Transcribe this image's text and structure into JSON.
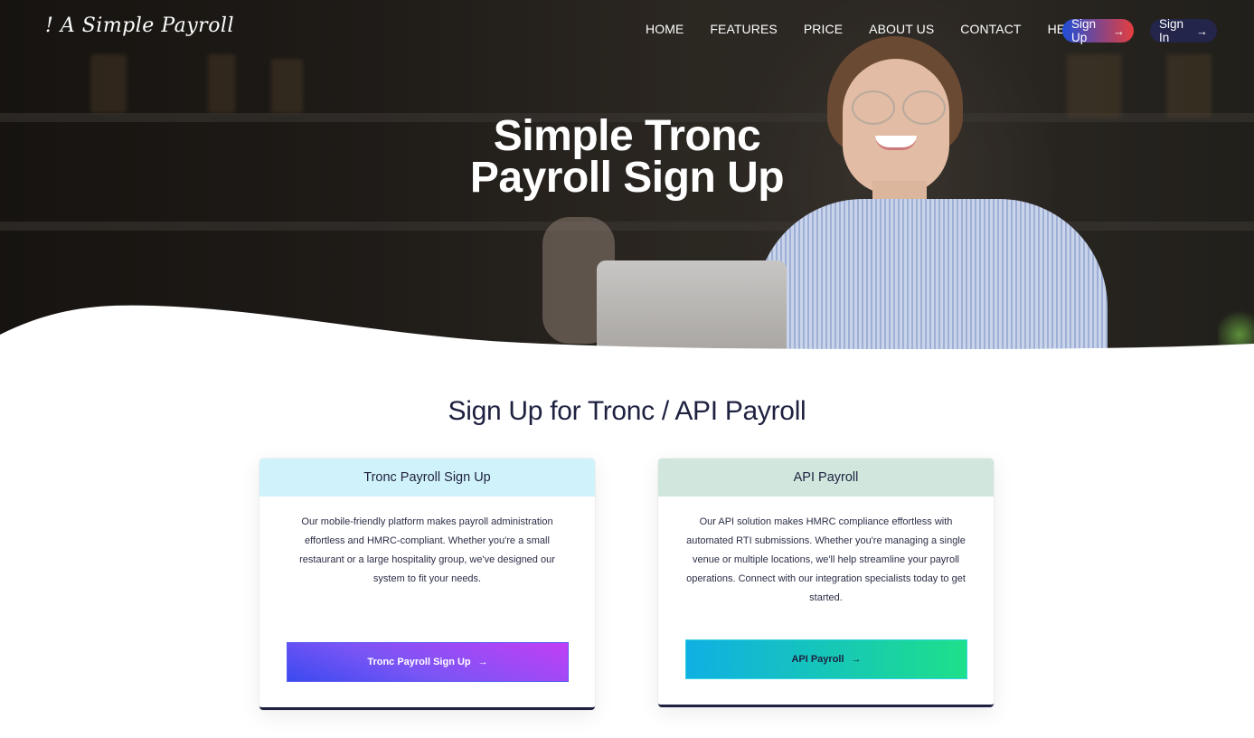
{
  "brand": {
    "logo_text": "! A Simple Payroll"
  },
  "nav": {
    "items": [
      "HOME",
      "FEATURES",
      "PRICE",
      "ABOUT US",
      "CONTACT",
      "HELP"
    ],
    "signup_label": "Sign Up",
    "signin_label": "Sign In",
    "arrow_glyph": "→"
  },
  "hero": {
    "title_line1": "Simple Tronc",
    "title_line2": "Payroll Sign Up"
  },
  "section": {
    "title": "Sign Up for Tronc / API Payroll"
  },
  "cards": [
    {
      "header": "Tronc Payroll Sign Up",
      "body": "Our mobile-friendly platform makes payroll administration effortless and HMRC-compliant. Whether you're a small restaurant or a large hospitality group, we've designed our system to fit your needs.",
      "button_label": "Tronc Payroll Sign Up",
      "header_color": "#d0f2fa"
    },
    {
      "header": "API Payroll",
      "body": "Our API solution makes HMRC compliance effortless with automated RTI submissions. Whether you're managing a single venue or multiple locations, we'll help streamline your payroll operations. Connect with our integration specialists today to get started.",
      "button_label": "API Payroll",
      "header_color": "#d1e7dd"
    }
  ],
  "colors": {
    "text_dark": "#1e2140",
    "signin_bg": "#23254a",
    "signup_gradient": [
      "#1d4ed8",
      "#e53e3e"
    ],
    "tronc_btn_gradient": [
      "#3b4af0",
      "#c23ff5"
    ],
    "api_btn_gradient": [
      "#0fb0e3",
      "#1ee08a"
    ]
  }
}
